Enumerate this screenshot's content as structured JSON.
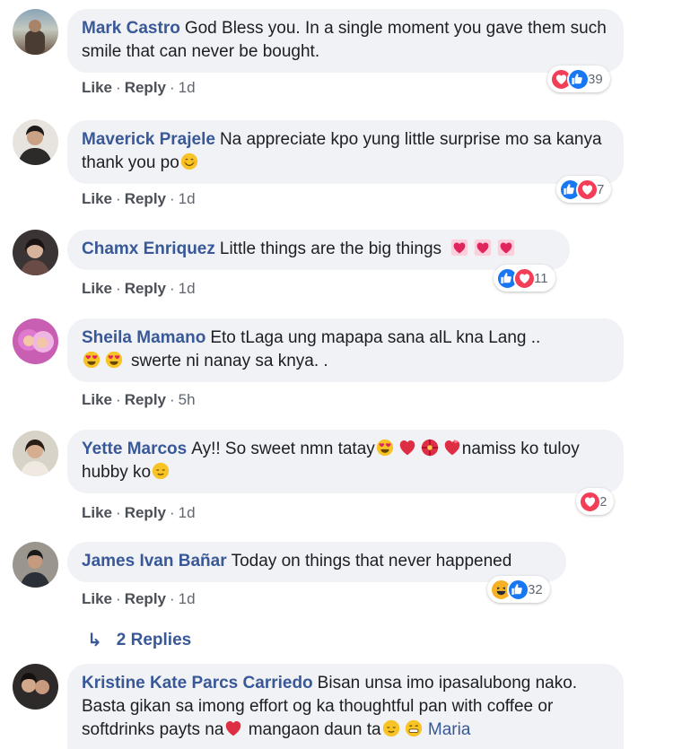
{
  "actions": {
    "like": "Like",
    "reply": "Reply",
    "sep": "·"
  },
  "comments": [
    {
      "author": "Mark Castro",
      "text": "God Bless you. In a single moment you gave them such smile that can never be bought.",
      "time": "1d",
      "reactions": [
        "love",
        "like"
      ],
      "count": "39"
    },
    {
      "author": "Maverick Prajele",
      "text": "Na appreciate kpo yung little surprise mo sa kanya thank you po",
      "time": "1d",
      "reactions": [
        "like",
        "love"
      ],
      "count": "7"
    },
    {
      "author": "Chamx Enriquez",
      "text": "Little things are the big things",
      "time": "1d",
      "reactions": [
        "like",
        "love"
      ],
      "count": "11"
    },
    {
      "author": "Sheila Mamano",
      "text": "Eto tLaga ung mapapa sana alL kna Lang ..",
      "text2": "swerte ni nanay sa knya. .",
      "time": "5h"
    },
    {
      "author": "Yette Marcos",
      "text": "Ay!! So sweet nmn tatay",
      "text2": "namiss ko tuloy hubby ko",
      "time": "1d",
      "reactions": [
        "love"
      ],
      "count": "2"
    },
    {
      "author": "James Ivan Bañar",
      "text": "Today on things that never happened",
      "time": "1d",
      "reactions": [
        "haha",
        "like"
      ],
      "count": "32"
    },
    {
      "author": "Kristine Kate Parcs Carriedo",
      "text": "Bisan unsa imo ipasalubong nako. Basta gikan sa imong effort og ka thoughtful pan with coffee or softdrinks payts na",
      "text2": "mangaon daun ta",
      "mention": "Maria"
    }
  ],
  "replies": {
    "label": "2 Replies"
  },
  "colors": {
    "bubble": "#f0f2f5",
    "author": "#385898",
    "like": "#1877f2",
    "love": "#f33e58",
    "haha": "#f7b125"
  }
}
